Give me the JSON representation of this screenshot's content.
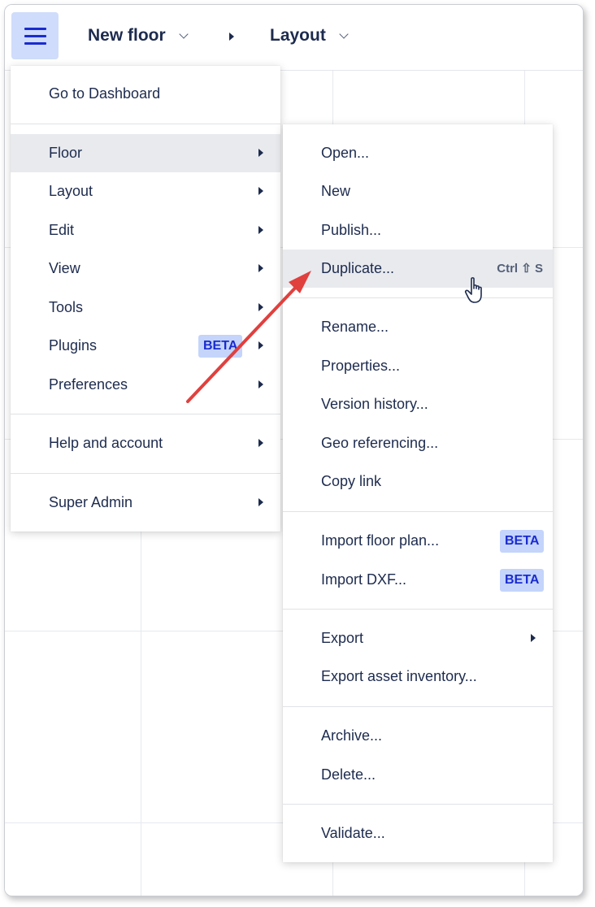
{
  "topbar": {
    "breadcrumb_floor": "New floor",
    "breadcrumb_layout": "Layout"
  },
  "main_menu": {
    "items": [
      {
        "label": "Go to Dashboard"
      },
      {
        "label": "Floor"
      },
      {
        "label": "Layout"
      },
      {
        "label": "Edit"
      },
      {
        "label": "View"
      },
      {
        "label": "Tools"
      },
      {
        "label": "Plugins",
        "badge": "BETA"
      },
      {
        "label": "Preferences"
      },
      {
        "label": "Help and account"
      },
      {
        "label": "Super Admin"
      }
    ]
  },
  "floor_menu": {
    "items": [
      {
        "label": "Open..."
      },
      {
        "label": "New"
      },
      {
        "label": "Publish..."
      },
      {
        "label": "Duplicate...",
        "shortcut": "Ctrl ⇧ S"
      },
      {
        "label": "Rename..."
      },
      {
        "label": "Properties..."
      },
      {
        "label": "Version history..."
      },
      {
        "label": "Geo referencing..."
      },
      {
        "label": "Copy link"
      },
      {
        "label": "Import floor plan...",
        "badge": "BETA"
      },
      {
        "label": "Import DXF...",
        "badge": "BETA"
      },
      {
        "label": "Export"
      },
      {
        "label": "Export asset inventory..."
      },
      {
        "label": "Archive..."
      },
      {
        "label": "Delete..."
      },
      {
        "label": "Validate..."
      }
    ]
  },
  "colors": {
    "accent": "#1a2bd0",
    "badge_bg": "#c4d4fb",
    "hover_bg": "#e8eaee",
    "annotation_arrow": "#e0403e"
  },
  "icons": {
    "menu": "hamburger-icon",
    "cursor": "hand-pointer-icon"
  }
}
